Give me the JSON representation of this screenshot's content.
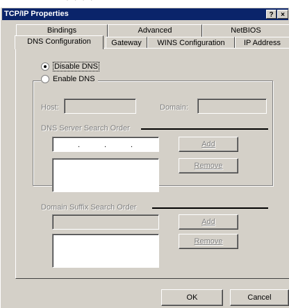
{
  "window": {
    "title": "TCP/IP Properties",
    "help_label": "?",
    "close_label": "×"
  },
  "tabs": {
    "row_back": [
      "Bindings",
      "Advanced",
      "NetBIOS"
    ],
    "row_front": [
      "DNS Configuration",
      "Gateway",
      "WINS Configuration",
      "IP Address"
    ],
    "active": "DNS Configuration"
  },
  "dns": {
    "disable_label": "Disable DNS",
    "enable_label": "Enable DNS",
    "selected": "Disable DNS"
  },
  "host_label": "Host:",
  "domain_label": "Domain:",
  "server_order": {
    "label": "DNS Server Search Order",
    "add_label": "Add",
    "remove_label": "Remove"
  },
  "suffix_order": {
    "label": "Domain Suffix Search Order",
    "add_label": "Add",
    "remove_label": "Remove"
  },
  "footer": {
    "ok_label": "OK",
    "cancel_label": "Cancel"
  }
}
